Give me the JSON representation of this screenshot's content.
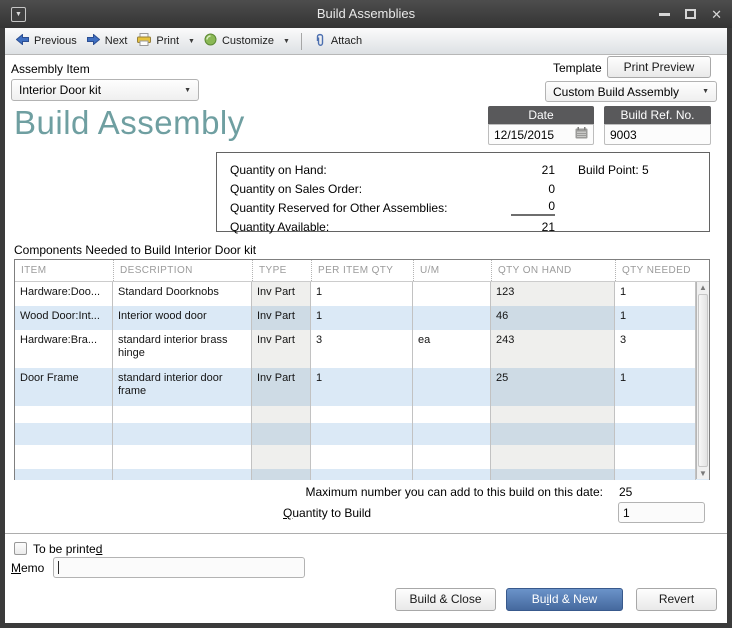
{
  "window": {
    "title": "Build Assemblies",
    "close_glyph": "✕",
    "sysmenu_glyph": "▼"
  },
  "icons": {
    "caret_down": "▼",
    "arrow_up": "▲",
    "arrow_down": "▼"
  },
  "toolbar": {
    "previous": "Previous",
    "next": "Next",
    "print": "Print",
    "customize": "Customize",
    "attach": "Attach"
  },
  "header": {
    "assembly_item_label": "Assembly Item",
    "assembly_item_value": "Interior Door kit",
    "template_label": "Template",
    "print_preview_label": "Print Preview",
    "template_value": "Custom Build Assembly",
    "page_title": "Build Assembly"
  },
  "refs": {
    "date_label": "Date",
    "date_value": "12/15/2015",
    "build_ref_label": "Build Ref. No.",
    "build_ref_value": "9003"
  },
  "quantity_info": {
    "on_hand_label": "Quantity on Hand:",
    "on_hand_value": "21",
    "build_point": "Build Point: 5",
    "sales_order_label": "Quantity on Sales Order:",
    "sales_order_value": "0",
    "reserved_label": "Quantity Reserved for Other Assemblies:",
    "reserved_value": "0",
    "available_label": "Quantity Available:",
    "available_value": "21"
  },
  "components": {
    "section_label": "Components Needed to Build  Interior Door kit",
    "columns": {
      "item": "ITEM",
      "description": "DESCRIPTION",
      "type": "TYPE",
      "per_item_qty": "PER ITEM QTY",
      "um": "U/M",
      "qty_on_hand": "QTY ON HAND",
      "qty_needed": "QTY NEEDED"
    },
    "rows": [
      {
        "item": "Hardware:Doo...",
        "description": "Standard Doorknobs",
        "type": "Inv Part",
        "per_item_qty": "1",
        "um": "",
        "qty_on_hand": "123",
        "qty_needed": "1"
      },
      {
        "item": "Wood Door:Int...",
        "description": "Interior wood door",
        "type": "Inv Part",
        "per_item_qty": "1",
        "um": "",
        "qty_on_hand": "46",
        "qty_needed": "1"
      },
      {
        "item": "Hardware:Bra...",
        "description": "standard interior brass hinge",
        "type": "Inv Part",
        "per_item_qty": "3",
        "um": "ea",
        "qty_on_hand": "243",
        "qty_needed": "3"
      },
      {
        "item": "Door Frame",
        "description": "standard interior door frame",
        "type": "Inv Part",
        "per_item_qty": "1",
        "um": "",
        "qty_on_hand": "25",
        "qty_needed": "1"
      }
    ]
  },
  "build": {
    "max_label": "Maximum number you can add to this build on this date:",
    "max_value": "25",
    "qty_mnemonic": "Q",
    "qty_label_rest": "uantity to Build",
    "qty_value": "1"
  },
  "footer": {
    "printed_prefix": "To be printe",
    "printed_mnemonic": "d",
    "memo_mnemonic": "M",
    "memo_rest": "emo",
    "memo_value": "",
    "build_close": "Build & Close",
    "build_new_prefix": "Bu",
    "build_new_mnemonic": "i",
    "build_new_suffix": "ld & New",
    "revert": "Revert"
  },
  "colors": {
    "accent_teal": "#6f9fa1",
    "primary_button": "#45699e",
    "row_alt_blue": "#dbe9f6",
    "field_header": "#59595b",
    "titlebar": "#3b3b3b"
  }
}
